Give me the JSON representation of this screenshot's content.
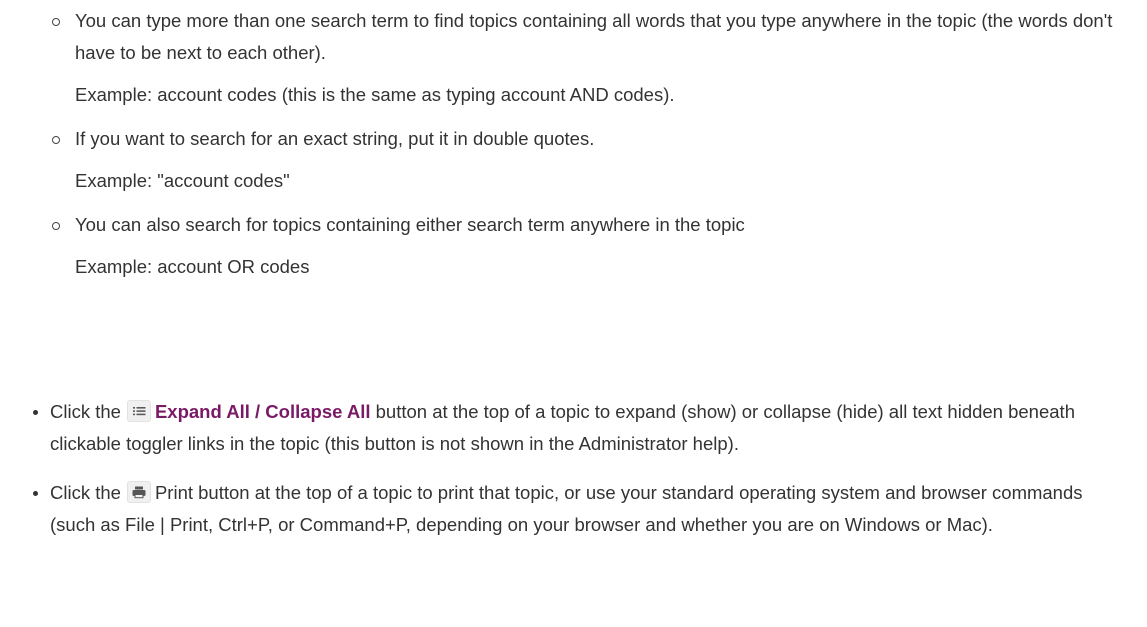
{
  "search_tips": [
    {
      "text": "You can type more than one search term to find topics containing all words that you type anywhere in the topic (the words don't have to be next to each other).",
      "example": "Example: account codes (this is the same as typing account AND codes)."
    },
    {
      "text": "If you want to search for an exact string, put it in double quotes.",
      "example": "Example: \"account codes\""
    },
    {
      "text": "You can also search for topics containing either search term anywhere in the topic",
      "example": "Example: account OR codes"
    }
  ],
  "expand_tip": {
    "prefix": "Click the",
    "button_label": "Expand All / Collapse All",
    "suffix": "button at the top of a topic to expand (show) or collapse (hide) all text hidden beneath clickable toggler links in the topic (this button is not shown in the Administrator help).",
    "icon": "list-icon"
  },
  "print_tip": {
    "prefix": "Click the",
    "suffix": "Print button at the top of a topic to print that topic, or use your standard operating system and browser commands (such as File | Print, Ctrl+P, or Command+P, depending on your browser and whether you are on Windows or Mac).",
    "icon": "printer-icon"
  },
  "colors": {
    "text": "#333333",
    "expand_label": "#7a1a66",
    "icon_bg": "#f0f0f0"
  }
}
